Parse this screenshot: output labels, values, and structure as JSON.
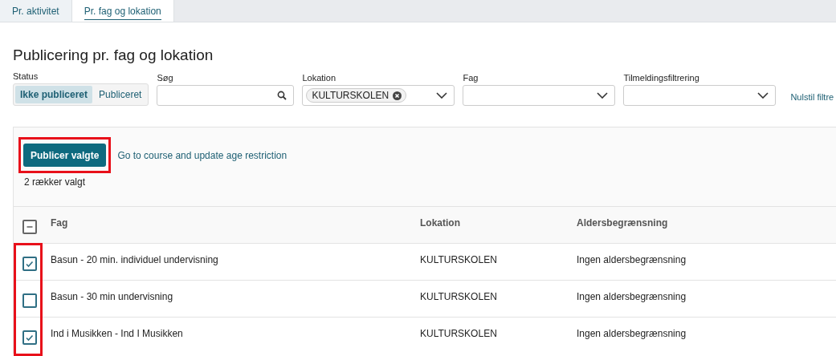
{
  "tabs": [
    {
      "label": "Pr. aktivitet",
      "selected": false
    },
    {
      "label": "Pr. fag og lokation",
      "selected": true
    }
  ],
  "title": "Publicering pr. fag og lokation",
  "filters": {
    "status": {
      "label": "Status",
      "options": [
        {
          "label": "Ikke publiceret",
          "selected": true
        },
        {
          "label": "Publiceret",
          "selected": false
        }
      ]
    },
    "search": {
      "label": "Søg"
    },
    "location": {
      "label": "Lokation",
      "chips": [
        "KULTURSKOLEN"
      ]
    },
    "subject": {
      "label": "Fag"
    },
    "enrollment": {
      "label": "Tilmeldingsfiltrering"
    },
    "reset": "Nulstil filtre"
  },
  "actions": {
    "publish_button": {
      "label": "Publicer valgte",
      "highlighted": true
    },
    "link": "Go to course and update age restriction",
    "selected_count": "2 rækker valgt"
  },
  "table": {
    "select_all_indeterminate": true,
    "checkbox_column_highlighted": true,
    "columns": [
      "Fag",
      "Lokation",
      "Aldersbegrænsning"
    ],
    "rows": [
      {
        "checked": true,
        "cells": [
          "Basun - 20 min. individuel undervisning",
          "KULTURSKOLEN",
          "Ingen aldersbegrænsning"
        ]
      },
      {
        "checked": false,
        "cells": [
          "Basun - 30 min undervisning",
          "KULTURSKOLEN",
          "Ingen aldersbegrænsning"
        ]
      },
      {
        "checked": true,
        "cells": [
          "Ind i Musikken - Ind I Musikken",
          "KULTURSKOLEN",
          "Ingen aldersbegrænsning"
        ]
      }
    ]
  }
}
